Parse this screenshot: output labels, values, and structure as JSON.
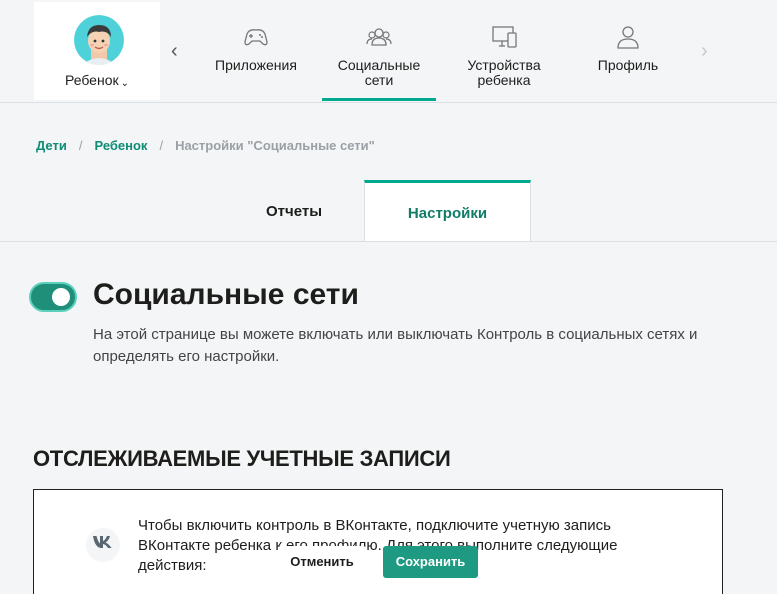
{
  "child": {
    "name": "Ребенок"
  },
  "nav": {
    "items": [
      {
        "label": "Приложения",
        "icon": "gamepad-icon"
      },
      {
        "label": "Социальные сети",
        "icon": "people-icon",
        "active": true
      },
      {
        "label_line1": "Устройства",
        "label_line2": "ребенка",
        "icon": "devices-icon"
      },
      {
        "label": "Профиль",
        "icon": "user-icon"
      }
    ]
  },
  "breadcrumb": {
    "items": [
      "Дети",
      "Ребенок"
    ],
    "separator": "/",
    "current": "Настройки \"Социальные сети\""
  },
  "tabs": {
    "reports": "Отчеты",
    "settings": "Настройки"
  },
  "page": {
    "title": "Социальные сети",
    "description": "На этой странице вы можете включать или выключать Контроль в социальных сетях и определять его настройки.",
    "toggle_on": true
  },
  "section": {
    "heading": "ОТСЛЕЖИВАЕМЫЕ УЧЕТНЫЕ ЗАПИСИ"
  },
  "account": {
    "text": "Чтобы включить контроль в ВКонтакте, подключите учетную запись ВКонтакте ребенка к его профилю. Для этого выполните следующие действия:"
  },
  "actions": {
    "cancel": "Отменить",
    "save": "Сохранить"
  },
  "colors": {
    "accent": "#00a88e",
    "toggle": "#1f8f79",
    "save_button": "#1f9a82",
    "link": "#0f8c74"
  }
}
